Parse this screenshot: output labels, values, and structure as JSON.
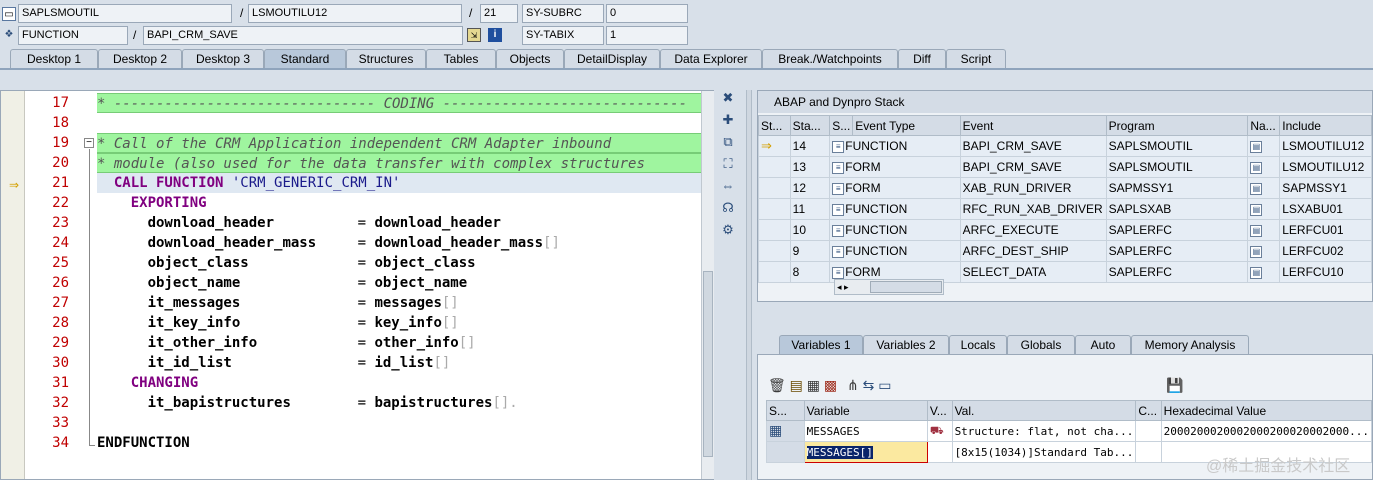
{
  "top": {
    "program": "SAPLSMOUTIL",
    "include": "LSMOUTILU12",
    "line": "21",
    "subrc_label": "SY-SUBRC",
    "subrc_val": "0",
    "type": "FUNCTION",
    "name": "BAPI_CRM_SAVE",
    "tabix_label": "SY-TABIX",
    "tabix_val": "1"
  },
  "tabs": [
    "Desktop 1",
    "Desktop 2",
    "Desktop 3",
    "Standard",
    "Structures",
    "Tables",
    "Objects",
    "DetailDisplay",
    "Data Explorer",
    "Break./Watchpoints",
    "Diff",
    "Script"
  ],
  "editor": {
    "lines": [
      "17",
      "18",
      "19",
      "20",
      "21",
      "22",
      "23",
      "24",
      "25",
      "26",
      "27",
      "28",
      "29",
      "30",
      "31",
      "32",
      "33",
      "34"
    ],
    "coding": "* ------------------------------- CODING -----------------------------",
    "cm1": "* Call of the CRM Application independent CRM Adapter inbound",
    "cm2": "* module (also used for the data transfer with complex structures",
    "call_kw": "CALL FUNCTION",
    "call_str": "'CRM_GENERIC_CRM_IN'",
    "exporting": "EXPORTING",
    "changing": "CHANGING",
    "endfunction": "ENDFUNCTION",
    "params": [
      {
        "name": "download_header",
        "value": "download_header",
        "tail": ""
      },
      {
        "name": "download_header_mass",
        "value": "download_header_mass",
        "tail": "[]"
      },
      {
        "name": "object_class",
        "value": "object_class",
        "tail": ""
      },
      {
        "name": "object_name",
        "value": "object_name",
        "tail": ""
      },
      {
        "name": "it_messages",
        "value": "messages",
        "tail": "[]"
      },
      {
        "name": "it_key_info",
        "value": "key_info",
        "tail": "[]"
      },
      {
        "name": "it_other_info",
        "value": "other_info",
        "tail": "[]"
      },
      {
        "name": "it_id_list",
        "value": "id_list",
        "tail": "[]"
      }
    ],
    "bapi_name": "it_bapistructures",
    "bapi_value": "bapistructures",
    "bapi_tail": "[]."
  },
  "stack": {
    "title": "ABAP and Dynpro Stack",
    "headers": [
      "St...",
      "Sta...",
      "S...",
      "Event Type",
      "Event",
      "Program",
      "Na...",
      "Include"
    ],
    "rows": [
      {
        "level": "14",
        "type": "FUNCTION",
        "event": "BAPI_CRM_SAVE",
        "program": "SAPLSMOUTIL",
        "include": "LSMOUTILU12"
      },
      {
        "level": "13",
        "type": "FORM",
        "event": "BAPI_CRM_SAVE",
        "program": "SAPLSMOUTIL",
        "include": "LSMOUTILU12"
      },
      {
        "level": "12",
        "type": "FORM",
        "event": "XAB_RUN_DRIVER",
        "program": "SAPMSSY1",
        "include": "SAPMSSY1"
      },
      {
        "level": "11",
        "type": "FUNCTION",
        "event": "RFC_RUN_XAB_DRIVER",
        "program": "SAPLSXAB",
        "include": "LSXABU01"
      },
      {
        "level": "10",
        "type": "FUNCTION",
        "event": "ARFC_EXECUTE",
        "program": "SAPLERFC",
        "include": "LERFCU01"
      },
      {
        "level": "9",
        "type": "FUNCTION",
        "event": "ARFC_DEST_SHIP",
        "program": "SAPLERFC",
        "include": "LERFCU02"
      },
      {
        "level": "8",
        "type": "FORM",
        "event": "SELECT_DATA",
        "program": "SAPLERFC",
        "include": "LERFCU10"
      }
    ]
  },
  "vartabs": [
    "Variables 1",
    "Variables 2",
    "Locals",
    "Globals",
    "Auto",
    "Memory Analysis"
  ],
  "vars": {
    "headers": [
      "S...",
      "Variable",
      "V...",
      "Val.",
      "C...",
      "Hexadecimal Value"
    ],
    "rows": [
      {
        "variable": "MESSAGES",
        "value": "Structure: flat, not cha...",
        "hex": "2000200020002000200020002000..."
      },
      {
        "variable": "MESSAGES[]",
        "value": "[8x15(1034)]Standard Tab...",
        "hex": ""
      }
    ]
  },
  "watermark": "@稀土掘金技术社区"
}
